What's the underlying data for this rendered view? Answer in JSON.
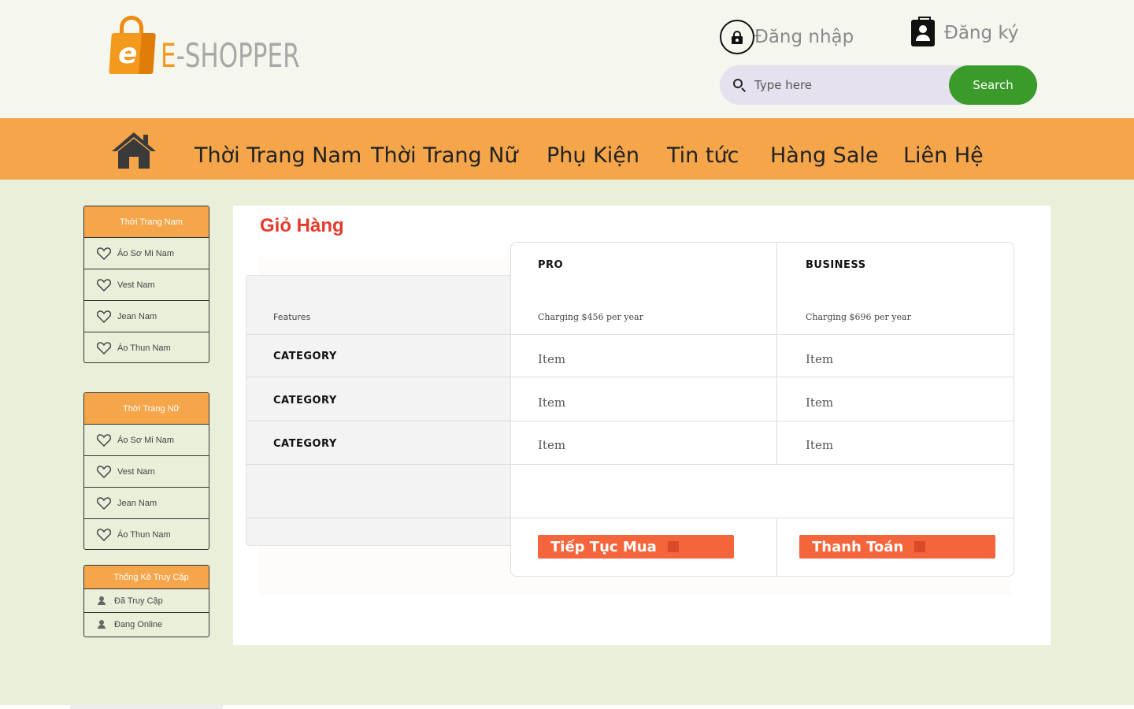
{
  "header": {
    "logo_letter": "e",
    "logo_first": "E",
    "logo_rest": "-SHOPPER",
    "login_label": "Đăng nhập",
    "register_label": "Đăng ký",
    "search_placeholder": "Type here",
    "search_button": "Search"
  },
  "nav": {
    "items": [
      "Thời Trang Nam",
      "Thời Trang Nữ",
      "Phụ Kiện",
      "Tin tức",
      "Hàng Sale",
      "Liên Hệ"
    ]
  },
  "sidebar": {
    "men": {
      "title": "Thời Trang Nam",
      "items": [
        "Áo Sơ Mi Nam",
        "Vest Nam",
        "Jean Nam",
        "Áo Thun Nam"
      ]
    },
    "women": {
      "title": "Thời Trang Nữ",
      "items": [
        "Áo Sơ Mi Nam",
        "Vest Nam",
        "Jean Nam",
        "Áo Thun Nam"
      ]
    },
    "stats": {
      "title": "Thống Kê Truy Cập",
      "items": [
        "Đã Truy Cập",
        "Đang Online"
      ]
    }
  },
  "cart": {
    "title": "Giỏ Hàng",
    "features_label": "Features",
    "plans": [
      {
        "name": "PRO",
        "price": "Charging $456 per year"
      },
      {
        "name": "BUSINESS",
        "price": "Charging $696 per year"
      }
    ],
    "rows": [
      {
        "category": "CATEGORY",
        "values": [
          "Item",
          "Item"
        ]
      },
      {
        "category": "CATEGORY",
        "values": [
          "Item",
          "Item"
        ]
      },
      {
        "category": "CATEGORY",
        "values": [
          "Item",
          "Item"
        ]
      }
    ],
    "continue_button": "Tiếp Tục Mua",
    "checkout_button": "Thanh Toán"
  },
  "colors": {
    "nav_bg": "#f5a64a",
    "page_bg": "#e9efd9",
    "search_btn": "#3a9a2a",
    "title_red": "#e63a2a",
    "action_btn": "#f5653c"
  }
}
